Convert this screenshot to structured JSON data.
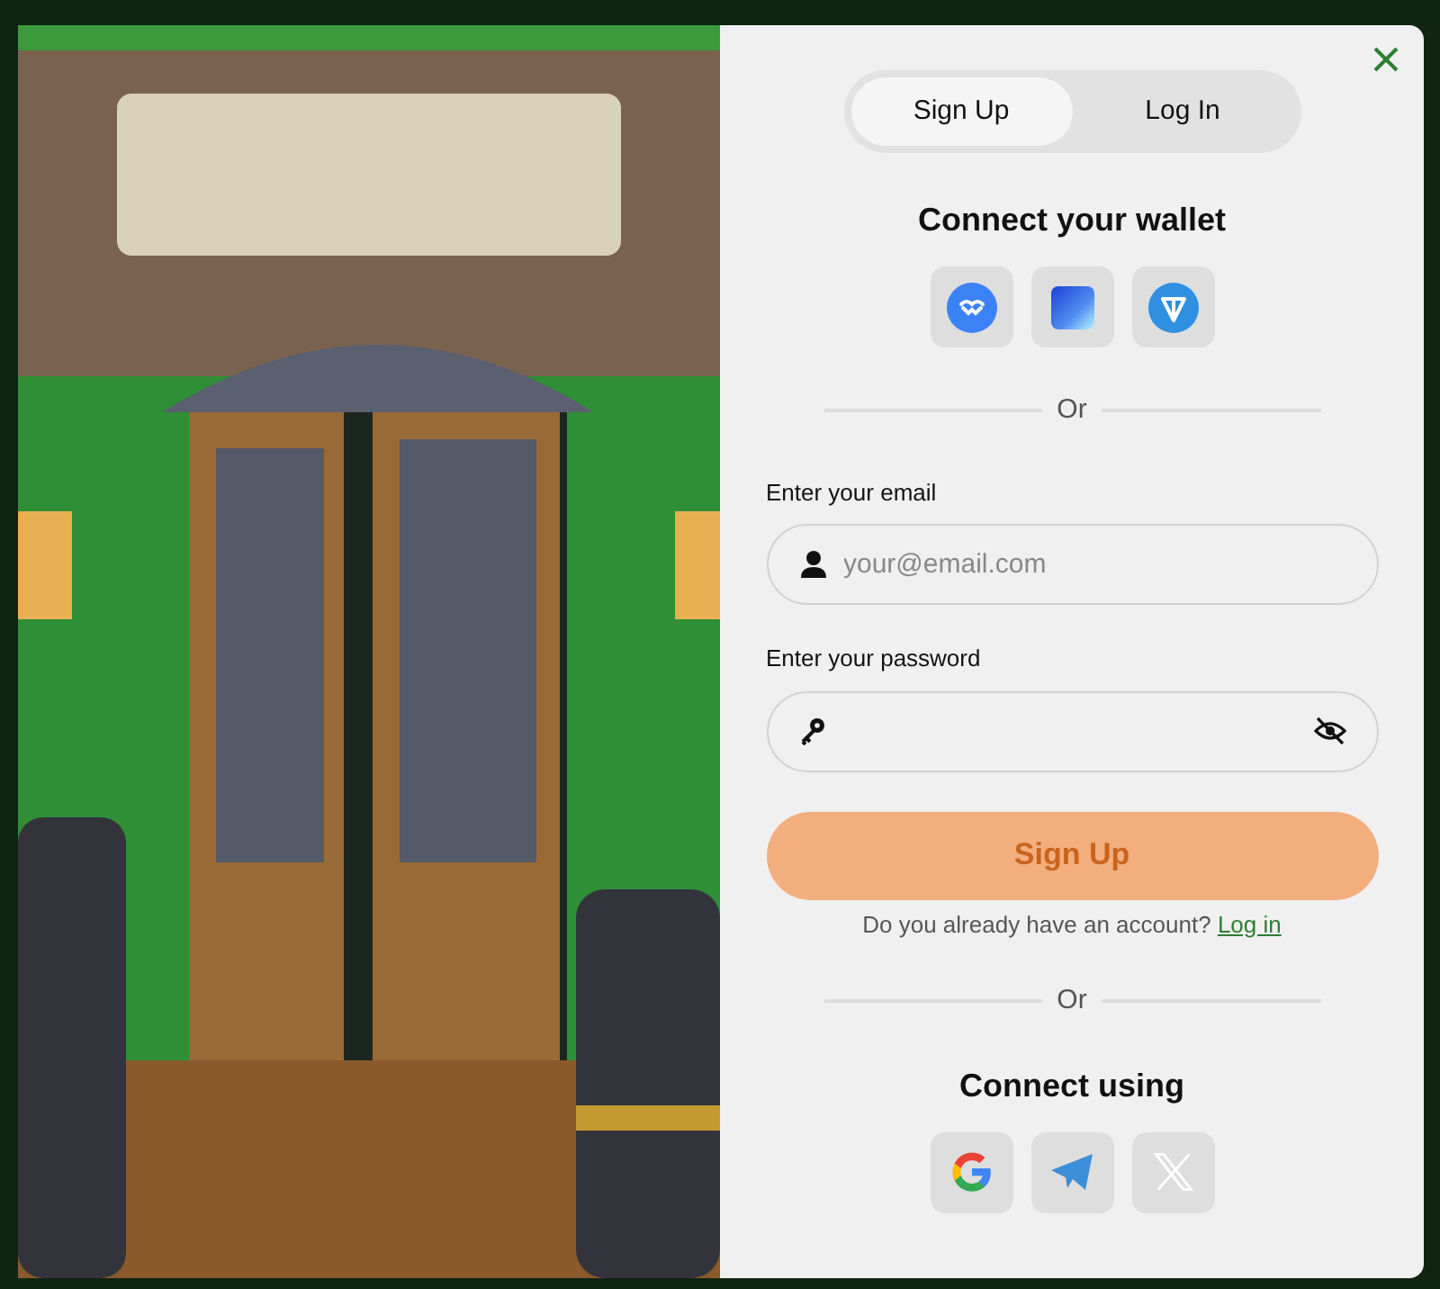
{
  "tabs": [
    {
      "label": "Sign Up",
      "selected": true
    },
    {
      "label": "Log In",
      "selected": false
    }
  ],
  "wallet": {
    "title": "Connect your wallet",
    "options": [
      {
        "kind": "walletconnect"
      },
      {
        "kind": "gradient"
      },
      {
        "kind": "ton"
      }
    ]
  },
  "divider_1": "Or",
  "email": {
    "label": "Enter your email",
    "placeholder": "your@email.com"
  },
  "password": {
    "label": "Enter your password"
  },
  "submit": "Sign Up",
  "account_prompt": {
    "text": "Do you already have an account?",
    "link": "Log in"
  },
  "divider_2": "Or",
  "social": {
    "title": "Connect using",
    "options": [
      {
        "kind": "google"
      },
      {
        "kind": "telegram"
      },
      {
        "kind": "x"
      }
    ]
  }
}
